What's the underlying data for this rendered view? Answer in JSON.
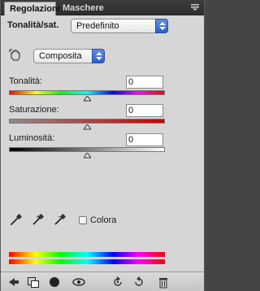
{
  "tabs": [
    {
      "label": "Regolazioni",
      "active": true
    },
    {
      "label": "Maschere",
      "active": false
    }
  ],
  "preset": {
    "label": "Tonalità/sat.",
    "value": "Predefinito"
  },
  "channel": {
    "value": "Composita"
  },
  "sliders": {
    "hue": {
      "label": "Tonalità:",
      "value": "0"
    },
    "saturation": {
      "label": "Saturazione:",
      "value": "0"
    },
    "lightness": {
      "label": "Luminosità:",
      "value": "0"
    }
  },
  "colorize": {
    "label": "Colora",
    "checked": false
  },
  "colors": {
    "accent": "#3b6fd6",
    "panel": "#d6d6d6",
    "tabbar": "#333333"
  },
  "icons": {
    "hand_tool": "target-adjust-hand-icon",
    "droppers": [
      "eyedropper-icon",
      "eyedropper-plus-icon",
      "eyedropper-minus-icon"
    ],
    "footer": [
      "back-arrow-icon",
      "clip-layer-icon",
      "mask-icon",
      "eye-icon",
      "previous-state-icon",
      "reset-icon",
      "trash-icon"
    ]
  }
}
